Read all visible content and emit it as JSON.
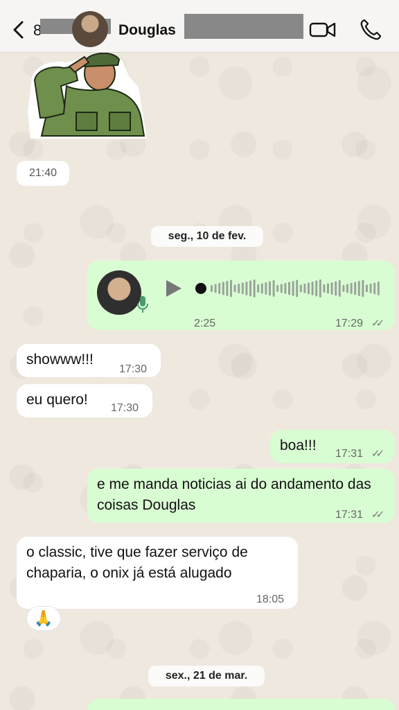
{
  "header": {
    "back_count": "8",
    "contact_name": "Douglas",
    "icons": [
      "back-chevron-icon",
      "video-call-icon",
      "phone-icon"
    ]
  },
  "sticker": {
    "description_icon": "saluting-soldier-sticker"
  },
  "sticker_time": "21:40",
  "dates": [
    "seg., 10 de fev.",
    "sex., 21 de mar."
  ],
  "messages": [
    {
      "type": "voice",
      "direction": "out",
      "duration": "2:25",
      "time": "17:29",
      "ticks": "✓✓"
    },
    {
      "type": "text",
      "direction": "in",
      "text": "showww!!!",
      "time": "17:30"
    },
    {
      "type": "text",
      "direction": "in",
      "text": "eu quero!",
      "time": "17:30"
    },
    {
      "type": "text",
      "direction": "out",
      "text": "boa!!!",
      "time": "17:31",
      "ticks": "✓✓"
    },
    {
      "type": "text",
      "direction": "out",
      "text": "e me manda noticias ai do andamento das coisas Douglas",
      "time": "17:31",
      "ticks": "✓✓"
    },
    {
      "type": "text",
      "direction": "in",
      "text": "o classic, tive que fazer serviço de chaparia, o onix já está alugado",
      "time": "18:05",
      "reaction": "🙏"
    }
  ],
  "colors": {
    "outgoing_bubble": "#d9fdd3",
    "incoming_bubble": "#ffffff",
    "header_bg": "#f6f5f3",
    "wallpaper": "#efe8de"
  }
}
